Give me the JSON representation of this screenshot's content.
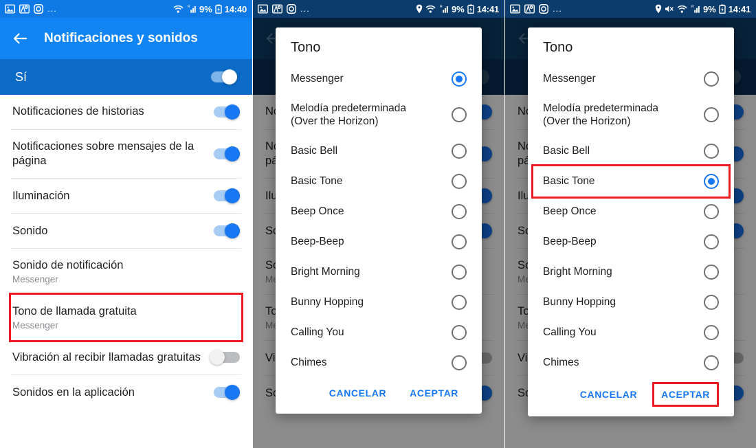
{
  "panels": [
    {
      "id": "settings-screen",
      "statusbar": {
        "left_icons": [
          "image-icon",
          "maps-pin-icon",
          "instagram-icon"
        ],
        "overflow": "...",
        "right_icons": [
          "wifi-icon",
          "signal-icon",
          "battery-icon"
        ],
        "battery_percent": "9%",
        "clock": "14:40"
      },
      "appbar": {
        "back_icon": "back-arrow-icon",
        "title": "Notificaciones y sonidos"
      },
      "master": {
        "label": "Sí",
        "toggle": "on"
      },
      "rows": [
        {
          "title": "Notificaciones de historias",
          "sub": "",
          "control": "toggle",
          "state": "on",
          "highlight": false
        },
        {
          "title": "Notificaciones sobre mensajes de la página",
          "sub": "",
          "control": "toggle",
          "state": "on",
          "highlight": false
        },
        {
          "title": "Iluminación",
          "sub": "",
          "control": "toggle",
          "state": "on",
          "highlight": false
        },
        {
          "title": "Sonido",
          "sub": "",
          "control": "toggle",
          "state": "on",
          "highlight": false
        },
        {
          "title": "Sonido de notificación",
          "sub": "Messenger",
          "control": "none",
          "state": "",
          "highlight": false
        },
        {
          "title": "Tono de llamada gratuita",
          "sub": "Messenger",
          "control": "none",
          "state": "",
          "highlight": true
        },
        {
          "title": "Vibración al recibir llamadas gratuitas",
          "sub": "",
          "control": "toggle",
          "state": "off",
          "highlight": false
        },
        {
          "title": "Sonidos en la aplicación",
          "sub": "",
          "control": "toggle",
          "state": "on",
          "highlight": false
        }
      ]
    },
    {
      "id": "dialog-open-messenger-selected",
      "statusbar": {
        "left_icons": [
          "image-icon",
          "maps-pin-icon",
          "instagram-icon"
        ],
        "overflow": "...",
        "right_icons": [
          "location-pin-icon",
          "wifi-icon",
          "signal-icon",
          "battery-icon"
        ],
        "battery_percent": "9%",
        "clock": "14:41"
      },
      "dialog": {
        "title": "Tono",
        "options": [
          {
            "label": "Messenger",
            "selected": true,
            "highlight": false
          },
          {
            "label": "Melodía predeterminada (Over the Horizon)",
            "selected": false,
            "highlight": false
          },
          {
            "label": "Basic Bell",
            "selected": false,
            "highlight": false
          },
          {
            "label": "Basic Tone",
            "selected": false,
            "highlight": false
          },
          {
            "label": "Beep Once",
            "selected": false,
            "highlight": false
          },
          {
            "label": "Beep-Beep",
            "selected": false,
            "highlight": false
          },
          {
            "label": "Bright Morning",
            "selected": false,
            "highlight": false
          },
          {
            "label": "Bunny Hopping",
            "selected": false,
            "highlight": false
          },
          {
            "label": "Calling You",
            "selected": false,
            "highlight": false
          },
          {
            "label": "Chimes",
            "selected": false,
            "highlight": false
          }
        ],
        "cancel_label": "CANCELAR",
        "accept_label": "ACEPTAR",
        "accept_highlight": false
      }
    },
    {
      "id": "dialog-open-basic-tone-selected",
      "statusbar": {
        "left_icons": [
          "image-icon",
          "maps-pin-icon",
          "instagram-icon"
        ],
        "overflow": "...",
        "right_icons": [
          "location-pin-icon",
          "mute-icon",
          "wifi-icon",
          "signal-icon",
          "battery-icon"
        ],
        "battery_percent": "9%",
        "clock": "14:41"
      },
      "dialog": {
        "title": "Tono",
        "options": [
          {
            "label": "Messenger",
            "selected": false,
            "highlight": false
          },
          {
            "label": "Melodía predeterminada (Over the Horizon)",
            "selected": false,
            "highlight": false
          },
          {
            "label": "Basic Bell",
            "selected": false,
            "highlight": false
          },
          {
            "label": "Basic Tone",
            "selected": true,
            "highlight": true
          },
          {
            "label": "Beep Once",
            "selected": false,
            "highlight": false
          },
          {
            "label": "Beep-Beep",
            "selected": false,
            "highlight": false
          },
          {
            "label": "Bright Morning",
            "selected": false,
            "highlight": false
          },
          {
            "label": "Bunny Hopping",
            "selected": false,
            "highlight": false
          },
          {
            "label": "Calling You",
            "selected": false,
            "highlight": false
          },
          {
            "label": "Chimes",
            "selected": false,
            "highlight": false
          }
        ],
        "cancel_label": "CANCELAR",
        "accept_label": "ACEPTAR",
        "accept_highlight": true
      }
    }
  ],
  "colors": {
    "accent_blue": "#1877f2",
    "appbar_blue": "#1285f5",
    "statusbar_blue": "#0f7ae5",
    "dim_navy": "#0d3c69",
    "annotation_red": "#ee1c22",
    "muted_text": "#8a8d91"
  }
}
